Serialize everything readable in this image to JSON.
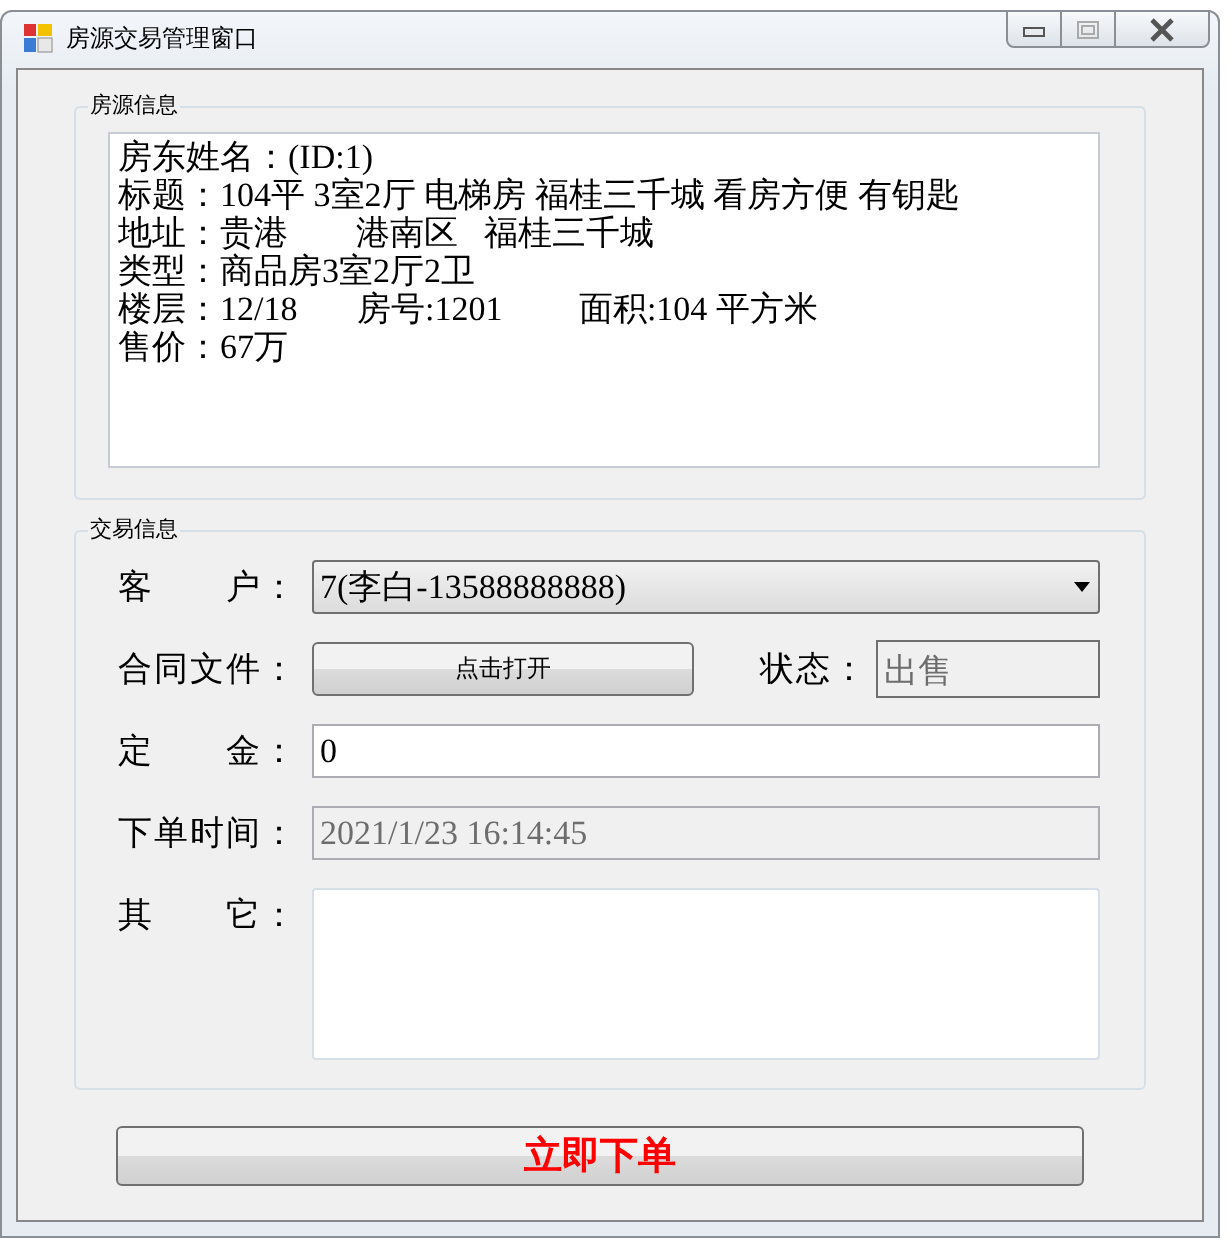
{
  "window": {
    "title": "房源交易管理窗口"
  },
  "property_group": {
    "title": "房源信息",
    "lines": [
      "房东姓名：(ID:1)",
      "标题：104平 3室2厅 电梯房 福桂三千城 看房方便 有钥匙",
      "地址：贵港        港南区   福桂三千城",
      "类型：商品房3室2厅2卫",
      "楼层：12/18       房号:1201         面积:104 平方米",
      "售价：67万"
    ]
  },
  "trade_group": {
    "title": "交易信息",
    "customer": {
      "label": "客　　户：",
      "value": "7(李白-13588888888)"
    },
    "contract": {
      "label": "合同文件：",
      "button": "点击打开"
    },
    "status": {
      "label": "状态：",
      "value": "出售",
      "disabled": true
    },
    "deposit": {
      "label": "定　　金：",
      "value": "0",
      "disabled": false
    },
    "order_time": {
      "label": "下单时间：",
      "value": "2021/1/23 16:14:45",
      "disabled": true
    },
    "other": {
      "label": "其　　它："
    }
  },
  "submit_button": "立即下单"
}
